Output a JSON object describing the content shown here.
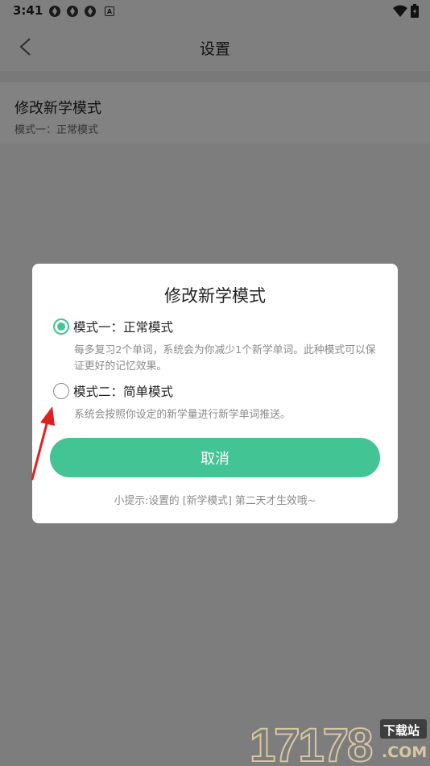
{
  "status_bar": {
    "time": "3:41",
    "keyboard_badge": "A"
  },
  "header": {
    "title": "设置"
  },
  "setting_item": {
    "title": "修改新学模式",
    "subtitle": "模式一：正常模式"
  },
  "dialog": {
    "title": "修改新学模式",
    "options": [
      {
        "label": "模式一：正常模式",
        "description": "每多复习2个单词，系统会为你减少1个新学单词。此种模式可以保证更好的记忆效果。",
        "selected": true
      },
      {
        "label": "模式二：简单模式",
        "description": "系统会按照你设定的新学量进行新学单词推送。",
        "selected": false
      }
    ],
    "cancel_label": "取消",
    "tip": "小提示:设置的 [新学模式] 第二天才生效哦~"
  },
  "watermark": {
    "brand": "17178",
    "tag": "下载站",
    "domain": ".COM"
  },
  "colors": {
    "accent": "#43c494",
    "overlay": "rgba(0,0,0,0.48)",
    "arrow": "#e02020"
  }
}
